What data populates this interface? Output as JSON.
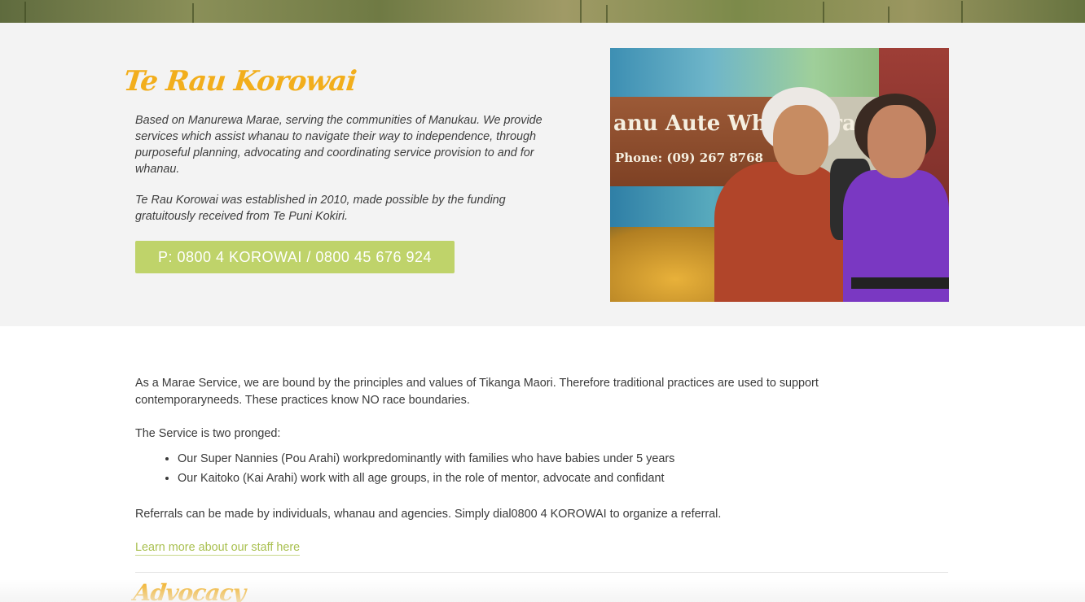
{
  "hero": {
    "title": "Te Rau Korowai",
    "paragraph1": "Based on Manurewa Marae, serving the communities of Manukau. We provide services which assist whanau to navigate their way to independence, through purposeful planning, advocating and coordinating service provision to and for whanau.",
    "paragraph2": "Te Rau Korowai was established in 2010, made possible by the funding gratuitously received from Te Puni Kokiri.",
    "phone_button": "P: 0800 4 KOROWAI / 0800 45 676 924",
    "photo": {
      "sign_line1": "anu Aute Whare Ora",
      "sign_line2": "Phone: (09) 267 8768"
    }
  },
  "main": {
    "intro": "As a Marae Service, we are bound by the principles and values of Tikanga Maori. Therefore traditional practices are used to support contemporaryneeds. These practices know NO race boundaries.",
    "service_label": "The Service is two pronged:",
    "service_items": [
      "Our Super Nannies (Pou Arahi) workpredominantly with families who have babies under 5 years",
      "Our Kaitoko (Kai Arahi) work with all age groups, in the role of mentor, advocate and confidant"
    ],
    "referrals": "Referrals can be made by individuals, whanau and agencies. Simply dial0800 4 KOROWAI to organize a referral.",
    "learn_more_link": "Learn more about our staff here",
    "next_section_title": "Advocacy"
  },
  "colors": {
    "accent_orange": "#f2ae1c",
    "accent_green": "#bfd36a",
    "link_green": "#a9c050",
    "hero_bg": "#f3f3f3"
  }
}
